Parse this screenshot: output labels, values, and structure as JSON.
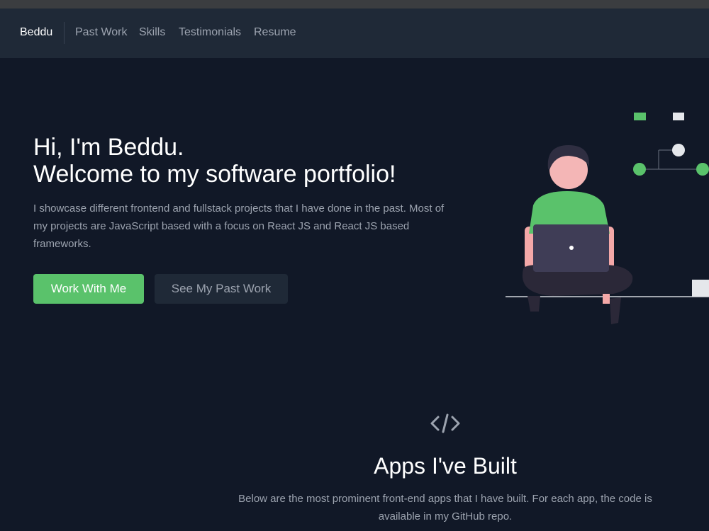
{
  "nav": {
    "brand": "Beddu",
    "links": [
      "Past Work",
      "Skills",
      "Testimonials",
      "Resume"
    ]
  },
  "hero": {
    "title_line1": "Hi, I'm Beddu.",
    "title_line2": "Welcome to my software portfolio!",
    "description": "I showcase different frontend and fullstack projects that I have done in the past. Most of my projects are JavaScript based with a focus on React JS and React JS based frameworks.",
    "primary_button": "Work With Me",
    "secondary_button": "See My Past Work"
  },
  "apps_section": {
    "icon": "code-icon",
    "title": "Apps I've Built",
    "description": "Below are the most prominent front-end apps that I have built. For each app, the code is available in my GitHub repo."
  },
  "colors": {
    "background": "#111827",
    "navbar": "#1f2937",
    "accent_green": "#5ac26b",
    "text_muted": "#9ca3af"
  }
}
